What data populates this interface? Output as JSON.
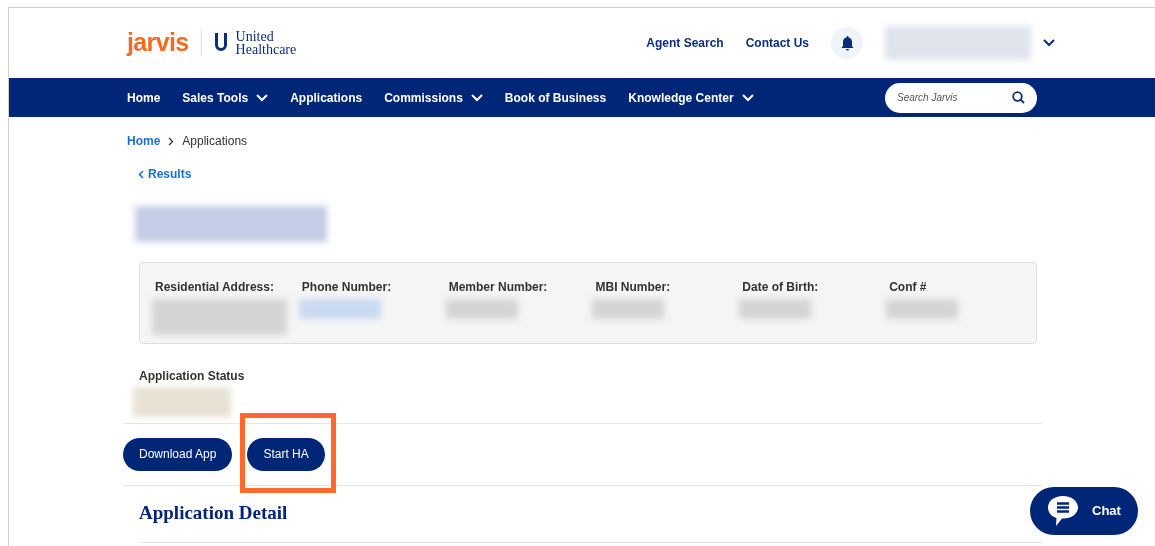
{
  "header": {
    "logo": "jarvis",
    "partner_line1": "United",
    "partner_line2": "Healthcare",
    "links": [
      "Agent Search",
      "Contact Us"
    ]
  },
  "nav": {
    "items": [
      {
        "label": "Home",
        "dropdown": false
      },
      {
        "label": "Sales Tools",
        "dropdown": true
      },
      {
        "label": "Applications",
        "dropdown": false
      },
      {
        "label": "Commissions",
        "dropdown": true
      },
      {
        "label": "Book of Business",
        "dropdown": false
      },
      {
        "label": "Knowledge Center",
        "dropdown": true
      }
    ],
    "search": {
      "placeholder": "Search Jarvis"
    }
  },
  "breadcrumb": [
    "Home",
    "Applications"
  ],
  "back_link": "Results",
  "details": [
    {
      "label": "Residential Address:",
      "kind": "multiline"
    },
    {
      "label": "Phone Number:",
      "kind": "link"
    },
    {
      "label": "Member Number:",
      "kind": "text"
    },
    {
      "label": "MBI Number:",
      "kind": "text"
    },
    {
      "label": "Date of Birth:",
      "kind": "text"
    },
    {
      "label": "Conf #",
      "kind": "text"
    }
  ],
  "status_label": "Application Status",
  "buttons": [
    {
      "label": "Download App",
      "highlighted": false
    },
    {
      "label": "Start HA",
      "highlighted": true
    }
  ],
  "section_title": "Application Detail",
  "chat": "Chat"
}
